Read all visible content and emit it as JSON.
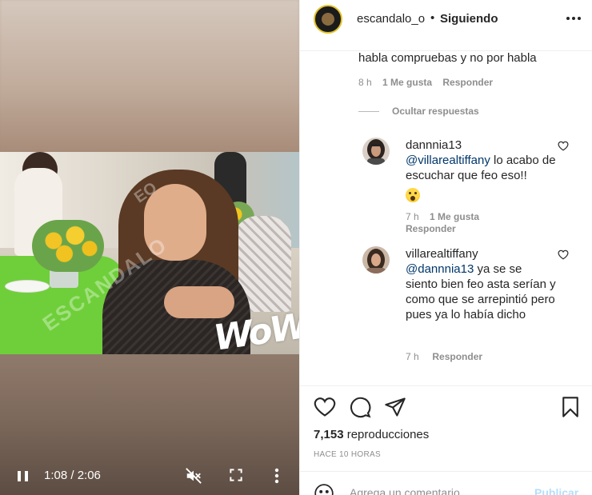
{
  "video": {
    "watermark": "ESCANDALO",
    "sticker": "WoW",
    "time_current": "1:08",
    "time_total": "2:06",
    "time_display": "1:08 / 2:06",
    "controls": {
      "pause_icon": "pause-icon",
      "mute_icon": "volume-muted-icon",
      "fullscreen_icon": "fullscreen-icon",
      "more_icon": "more-vertical-icon"
    }
  },
  "header": {
    "username": "escandalo_o",
    "bullet": "•",
    "following": "Siguiendo",
    "more_icon": "more-horizontal-icon"
  },
  "comments": {
    "parent": {
      "text": "habla compruebas y no por habla",
      "time": "8 h",
      "likes": "1 Me gusta",
      "reply": "Responder"
    },
    "hide_replies": "Ocultar respuestas",
    "replies": [
      {
        "user": "dannnia13",
        "mention": "@villarealtiffany",
        "text": " lo acabo de escuchar que feo eso!!",
        "emoji": "astonished-face-emoji",
        "time": "7 h",
        "likes": "1 Me gusta",
        "reply": "Responder"
      },
      {
        "user": "villarealtiffany",
        "mention": "@dannnia13",
        "text": " ya se se siento bien feo asta serían y como que se arrepintió pero pues ya lo había dicho",
        "time": "7 h",
        "reply": "Responder"
      }
    ]
  },
  "actions": {
    "icons": [
      "heart-icon",
      "comment-icon",
      "share-icon",
      "bookmark-icon"
    ],
    "views_count": "7,153",
    "views_label": " reproducciones",
    "time_ago": "HACE 10 HORAS"
  },
  "composer": {
    "placeholder": "Agrega un comentario...",
    "publish": "Publicar"
  },
  "colors": {
    "text": "#262626",
    "secondary": "#8e8e8e",
    "link": "#00376b",
    "publish_disabled": "#b2dffc",
    "divider": "#efefef"
  }
}
